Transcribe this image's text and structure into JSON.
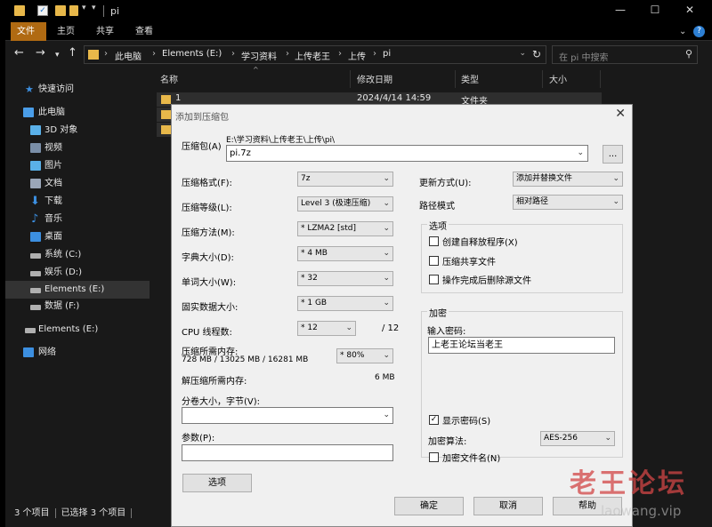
{
  "titlebar": {
    "title": "pi"
  },
  "ribbon": {
    "tabs": [
      "文件",
      "主页",
      "共享",
      "查看"
    ],
    "active_color": "#b06a12"
  },
  "address": {
    "crumbs": [
      "此电脑",
      "Elements (E:)",
      "学习资料",
      "上传老王",
      "上传",
      "pi"
    ]
  },
  "search": {
    "placeholder": "在 pi 中搜索"
  },
  "sidebar": {
    "items": [
      {
        "label": "快速访问",
        "icon": "star-icon",
        "color": "#3c8fe0"
      },
      {
        "label": "此电脑",
        "icon": "computer-icon",
        "color": "#4a9de8"
      },
      {
        "label": "3D 对象",
        "icon": "cube-icon",
        "color": "#5ab0e8"
      },
      {
        "label": "视频",
        "icon": "video-icon",
        "color": "#7b8fa8"
      },
      {
        "label": "图片",
        "icon": "picture-icon",
        "color": "#5ab0e8"
      },
      {
        "label": "文档",
        "icon": "document-icon",
        "color": "#9aa6b8"
      },
      {
        "label": "下载",
        "icon": "download-icon",
        "color": "#3c8fe0"
      },
      {
        "label": "音乐",
        "icon": "music-icon",
        "color": "#3c8fe0"
      },
      {
        "label": "桌面",
        "icon": "desktop-icon",
        "color": "#3c8fe0"
      },
      {
        "label": "系统 (C:)",
        "icon": "drive-icon",
        "color": "#b0b0b0"
      },
      {
        "label": "娱乐 (D:)",
        "icon": "drive-icon",
        "color": "#b0b0b0"
      },
      {
        "label": "Elements (E:)",
        "icon": "drive-icon",
        "color": "#b0b0b0"
      },
      {
        "label": "数据 (F:)",
        "icon": "drive-icon",
        "color": "#b0b0b0"
      },
      {
        "label": "Elements (E:)",
        "icon": "drive-icon",
        "color": "#b0b0b0"
      },
      {
        "label": "网络",
        "icon": "network-icon",
        "color": "#3c8fe0"
      }
    ]
  },
  "columns": {
    "name": "名称",
    "date": "修改日期",
    "type": "类型",
    "size": "大小"
  },
  "rows": [
    {
      "name": "1",
      "date": "2024/4/14 14:59",
      "type": "文件夹"
    }
  ],
  "status": {
    "count": "3 个项目",
    "selected": "已选择 3 个项目"
  },
  "dialog": {
    "title": "添加到压缩包",
    "archive_label": "压缩包(A)",
    "archive_path": "E:\\学习资料\\上传老王\\上传\\pi\\",
    "archive_name": "pi.7z",
    "browse": "...",
    "format_label": "压缩格式(F):",
    "format_value": "7z",
    "level_label": "压缩等级(L):",
    "level_value": "Level 3 (极速压缩)",
    "method_label": "压缩方法(M):",
    "method_value": "* LZMA2 [std]",
    "dict_label": "字典大小(D):",
    "dict_value": "* 4 MB",
    "word_label": "单词大小(W):",
    "word_value": "* 32",
    "solid_label": "固实数据大小:",
    "solid_value": "* 1 GB",
    "cpu_label": "CPU 线程数:",
    "cpu_value": "* 12",
    "cpu_total": "/ 12",
    "mem_label": "压缩所需内存:",
    "mem_value": "728 MB / 13025 MB / 16281 MB",
    "mem_percent": "* 80%",
    "decomp_label": "解压缩所需内存:",
    "decomp_value": "6 MB",
    "split_label": "分卷大小，字节(V):",
    "split_value": "",
    "params_label": "参数(P):",
    "params_value": "",
    "options_button": "选项",
    "update_label": "更新方式(U):",
    "update_value": "添加并替换文件",
    "path_label": "路径模式",
    "path_value": "相对路径",
    "options_group": "选项",
    "opt_sfx": "创建自释放程序(X)",
    "opt_shared": "压缩共享文件",
    "opt_delete": "操作完成后删除源文件",
    "encrypt_group": "加密",
    "password_label": "输入密码:",
    "password_value": "上老王论坛当老王",
    "show_password": "显示密码(S)",
    "algo_label": "加密算法:",
    "algo_value": "AES-256",
    "encrypt_names": "加密文件名(N)",
    "ok": "确定",
    "cancel": "取消",
    "help": "帮助"
  },
  "watermark": {
    "text": "老王论坛",
    "url": "laowang.vip"
  }
}
